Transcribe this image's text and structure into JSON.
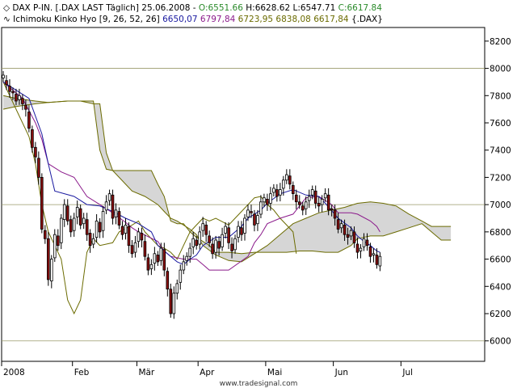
{
  "legend": {
    "line1": {
      "name": "DAX P-IN. [.DAX LAST Täglich] 25.06.2008",
      "open": "O:6551.66",
      "high": "H:6628.62",
      "low": "L:6547.71",
      "close": "C:6617.84"
    },
    "line2": {
      "name": "Ichimoku Kinko Hyo [9, 26, 52, 26]",
      "v1": "6650,07",
      "v2": "6797,84",
      "v3": "6723,95",
      "v4": "6838,08",
      "v5": "6617,84",
      "tail": "{.DAX}"
    }
  },
  "footer": "www.tradesignal.com",
  "colors": {
    "up": "#ffffff",
    "down": "#8b1010",
    "tenkan": "#1a1aa0",
    "kijun": "#8b1a8b",
    "span": "#6b6b00",
    "cloud": "#cfcfcf",
    "hline": "#6b6b00"
  },
  "chart_data": {
    "type": "candlestick",
    "ylim": [
      5850,
      8300
    ],
    "yticks": [
      6000,
      6200,
      6400,
      6600,
      6800,
      7000,
      7200,
      7400,
      7600,
      7800,
      8000,
      8200
    ],
    "grid_y": [
      6000,
      7000,
      8000
    ],
    "xticks": [
      {
        "label": "2008",
        "i": 0
      },
      {
        "label": "Feb",
        "i": 22
      },
      {
        "label": "Mär",
        "i": 42
      },
      {
        "label": "Apr",
        "i": 61
      },
      {
        "label": "Mai",
        "i": 82
      },
      {
        "label": "Jun",
        "i": 103
      },
      {
        "label": "Jul",
        "i": 124
      }
    ],
    "total_slots": 150,
    "close": [
      7950,
      7880,
      7830,
      7820,
      7760,
      7800,
      7740,
      7700,
      7560,
      7420,
      7350,
      7200,
      6820,
      6750,
      6450,
      6600,
      6780,
      6700,
      6900,
      7000,
      6880,
      6800,
      6900,
      6980,
      6850,
      6900,
      6780,
      6700,
      6750,
      6880,
      6800,
      6950,
      7020,
      7080,
      6900,
      6960,
      6850,
      6780,
      6850,
      6700,
      6640,
      6720,
      6800,
      6740,
      6620,
      6520,
      6560,
      6640,
      6580,
      6680,
      6520,
      6380,
      6200,
      6350,
      6420,
      6520,
      6580,
      6620,
      6680,
      6750,
      6700,
      6800,
      6860,
      6780,
      6720,
      6640,
      6740,
      6680,
      6780,
      6840,
      6720,
      6660,
      6750,
      6840,
      6780,
      6900,
      6960,
      6940,
      6850,
      6920,
      7020,
      7050,
      7000,
      7080,
      7120,
      7060,
      7110,
      7180,
      7220,
      7150,
      7080,
      7020,
      7000,
      6960,
      7020,
      7060,
      7110,
      7010,
      6990,
      7040,
      7080,
      6960,
      6960,
      6900,
      6820,
      6860,
      6780,
      6760,
      6810,
      6720,
      6650,
      6680,
      6750,
      6700,
      6620,
      6640,
      6560,
      6620
    ],
    "candle_deltas": [
      -20,
      30,
      40,
      10,
      50,
      -30,
      40,
      30,
      120,
      130,
      70,
      140,
      380,
      60,
      300,
      -160,
      -170,
      70,
      -180,
      -110,
      110,
      90,
      -90,
      -70,
      120,
      -40,
      110,
      90,
      -40,
      -120,
      70,
      -140,
      -60,
      -50,
      170,
      -50,
      100,
      60,
      -60,
      140,
      60,
      -70,
      -70,
      50,
      110,
      90,
      -30,
      -70,
      50,
      -90,
      150,
      130,
      180,
      -150,
      -70,
      -90,
      -60,
      -30,
      -60,
      -60,
      40,
      -90,
      -50,
      70,
      50,
      70,
      -90,
      50,
      -90,
      -50,
      110,
      50,
      -80,
      -80,
      50,
      -110,
      -50,
      10,
      80,
      -60,
      -90,
      -30,
      40,
      -70,
      -30,
      50,
      -40,
      -60,
      -40,
      60,
      60,
      50,
      20,
      30,
      -50,
      -30,
      -40,
      90,
      20,
      -40,
      -30,
      110,
      10,
      60,
      70,
      -30,
      70,
      20,
      -40,
      80,
      60,
      -20,
      -60,
      40,
      70,
      -10,
      70,
      -70
    ],
    "tenkan": [
      [
        0,
        7900
      ],
      [
        8,
        7780
      ],
      [
        12,
        7520
      ],
      [
        14,
        7300
      ],
      [
        16,
        7100
      ],
      [
        22,
        7060
      ],
      [
        26,
        7000
      ],
      [
        30,
        6990
      ],
      [
        34,
        6950
      ],
      [
        38,
        6900
      ],
      [
        42,
        6860
      ],
      [
        46,
        6800
      ],
      [
        48,
        6700
      ],
      [
        50,
        6660
      ],
      [
        52,
        6620
      ],
      [
        54,
        6580
      ],
      [
        56,
        6560
      ],
      [
        58,
        6600
      ],
      [
        60,
        6630
      ],
      [
        62,
        6700
      ],
      [
        66,
        6760
      ],
      [
        70,
        6760
      ],
      [
        74,
        6840
      ],
      [
        76,
        6900
      ],
      [
        80,
        6960
      ],
      [
        82,
        7010
      ],
      [
        86,
        7080
      ],
      [
        90,
        7110
      ],
      [
        94,
        7070
      ],
      [
        98,
        7060
      ],
      [
        100,
        7010
      ],
      [
        104,
        6900
      ],
      [
        108,
        6830
      ],
      [
        110,
        6770
      ],
      [
        112,
        6730
      ],
      [
        114,
        6700
      ],
      [
        116,
        6660
      ],
      [
        117,
        6650
      ]
    ],
    "kijun": [
      [
        0,
        7900
      ],
      [
        6,
        7780
      ],
      [
        10,
        7600
      ],
      [
        12,
        7480
      ],
      [
        14,
        7300
      ],
      [
        18,
        7240
      ],
      [
        22,
        7200
      ],
      [
        26,
        7060
      ],
      [
        30,
        7000
      ],
      [
        34,
        6940
      ],
      [
        38,
        6870
      ],
      [
        40,
        6830
      ],
      [
        42,
        6800
      ],
      [
        48,
        6730
      ],
      [
        50,
        6660
      ],
      [
        52,
        6620
      ],
      [
        56,
        6600
      ],
      [
        60,
        6600
      ],
      [
        62,
        6560
      ],
      [
        64,
        6520
      ],
      [
        70,
        6520
      ],
      [
        76,
        6620
      ],
      [
        78,
        6720
      ],
      [
        80,
        6780
      ],
      [
        82,
        6860
      ],
      [
        86,
        6900
      ],
      [
        90,
        6930
      ],
      [
        94,
        7050
      ],
      [
        98,
        7060
      ],
      [
        102,
        7000
      ],
      [
        104,
        6940
      ],
      [
        108,
        6940
      ],
      [
        110,
        6930
      ],
      [
        114,
        6880
      ],
      [
        116,
        6840
      ],
      [
        117,
        6800
      ]
    ],
    "senkou_a": [
      [
        0,
        7800
      ],
      [
        4,
        7780
      ],
      [
        10,
        7760
      ],
      [
        14,
        7750
      ],
      [
        20,
        7760
      ],
      [
        24,
        7760
      ],
      [
        28,
        7740
      ],
      [
        30,
        7740
      ],
      [
        32,
        7380
      ],
      [
        34,
        7250
      ],
      [
        38,
        7150
      ],
      [
        40,
        7100
      ],
      [
        44,
        7060
      ],
      [
        48,
        7000
      ],
      [
        50,
        6950
      ],
      [
        52,
        6900
      ],
      [
        54,
        6880
      ],
      [
        56,
        6850
      ],
      [
        58,
        6820
      ],
      [
        60,
        6780
      ],
      [
        62,
        6700
      ],
      [
        66,
        6630
      ],
      [
        70,
        6590
      ],
      [
        74,
        6580
      ],
      [
        78,
        6640
      ],
      [
        82,
        6700
      ],
      [
        86,
        6780
      ],
      [
        90,
        6860
      ],
      [
        94,
        6900
      ],
      [
        98,
        6940
      ],
      [
        102,
        6960
      ],
      [
        106,
        6980
      ],
      [
        110,
        7010
      ],
      [
        114,
        7020
      ],
      [
        118,
        7010
      ],
      [
        122,
        6990
      ],
      [
        126,
        6930
      ],
      [
        130,
        6880
      ],
      [
        133,
        6840
      ],
      [
        136,
        6840
      ],
      [
        139,
        6840
      ]
    ],
    "senkou_b": [
      [
        0,
        7700
      ],
      [
        4,
        7720
      ],
      [
        10,
        7740
      ],
      [
        14,
        7750
      ],
      [
        20,
        7760
      ],
      [
        28,
        7760
      ],
      [
        30,
        7400
      ],
      [
        32,
        7260
      ],
      [
        34,
        7250
      ],
      [
        40,
        7250
      ],
      [
        44,
        7250
      ],
      [
        46,
        7250
      ],
      [
        48,
        7150
      ],
      [
        50,
        7060
      ],
      [
        52,
        6880
      ],
      [
        54,
        6860
      ],
      [
        56,
        6860
      ],
      [
        58,
        6800
      ],
      [
        60,
        6760
      ],
      [
        64,
        6700
      ],
      [
        66,
        6650
      ],
      [
        68,
        6650
      ],
      [
        70,
        6650
      ],
      [
        74,
        6640
      ],
      [
        78,
        6650
      ],
      [
        84,
        6650
      ],
      [
        88,
        6650
      ],
      [
        92,
        6660
      ],
      [
        96,
        6660
      ],
      [
        100,
        6650
      ],
      [
        104,
        6650
      ],
      [
        108,
        6700
      ],
      [
        110,
        6750
      ],
      [
        114,
        6770
      ],
      [
        118,
        6770
      ],
      [
        122,
        6800
      ],
      [
        126,
        6830
      ],
      [
        130,
        6860
      ],
      [
        133,
        6800
      ],
      [
        136,
        6740
      ],
      [
        139,
        6740
      ]
    ],
    "chikou": [
      [
        0,
        7900
      ],
      [
        4,
        7700
      ],
      [
        8,
        7500
      ],
      [
        10,
        7300
      ],
      [
        12,
        7000
      ],
      [
        14,
        6800
      ],
      [
        16,
        6700
      ],
      [
        18,
        6600
      ],
      [
        20,
        6300
      ],
      [
        22,
        6200
      ],
      [
        24,
        6300
      ],
      [
        26,
        6650
      ],
      [
        28,
        6750
      ],
      [
        30,
        6700
      ],
      [
        34,
        6720
      ],
      [
        36,
        6800
      ],
      [
        40,
        6850
      ],
      [
        42,
        6880
      ],
      [
        44,
        6800
      ],
      [
        46,
        6750
      ],
      [
        48,
        6700
      ],
      [
        50,
        6680
      ],
      [
        52,
        6650
      ],
      [
        54,
        6600
      ],
      [
        56,
        6700
      ],
      [
        58,
        6800
      ],
      [
        60,
        6850
      ],
      [
        62,
        6900
      ],
      [
        64,
        6880
      ],
      [
        66,
        6900
      ],
      [
        70,
        6850
      ],
      [
        72,
        6900
      ],
      [
        74,
        6950
      ],
      [
        76,
        7000
      ],
      [
        78,
        7050
      ],
      [
        80,
        7060
      ],
      [
        82,
        7000
      ],
      [
        84,
        6960
      ],
      [
        86,
        6900
      ],
      [
        88,
        6850
      ],
      [
        90,
        6800
      ],
      [
        91,
        6640
      ]
    ],
    "cloud_shift": 26
  }
}
